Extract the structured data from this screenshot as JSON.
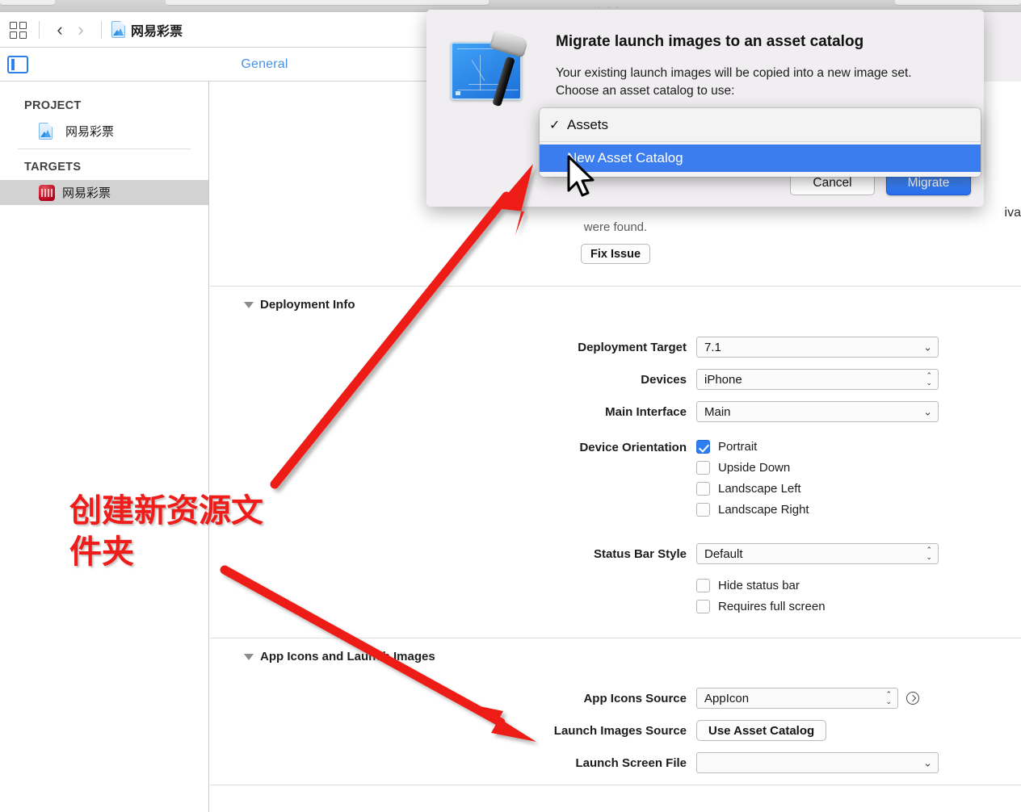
{
  "window": {
    "toolbar": {
      "grid_icon": "grid-icon",
      "back_icon": "‹",
      "forward_icon": "›",
      "breadcrumb_project": "网易彩票"
    },
    "tabbar": {
      "panel_toggle_icon": "left-panel-toggle-icon",
      "active_tab": "General"
    }
  },
  "sidebar": {
    "project_header": "PROJECT",
    "project_items": [
      {
        "label": "网易彩票",
        "icon": "project-file-icon"
      }
    ],
    "targets_header": "TARGETS",
    "target_items": [
      {
        "label": "网易彩票",
        "icon": "app-target-icon",
        "selected": true
      }
    ]
  },
  "content": {
    "issue": {
      "text": "were found.",
      "fix_button": "Fix Issue"
    },
    "deployment_info": {
      "section_title": "Deployment Info",
      "rows": [
        {
          "label": "Deployment Target",
          "value": "7.1",
          "control": "combo"
        },
        {
          "label": "Devices",
          "value": "iPhone",
          "control": "popup"
        },
        {
          "label": "Main Interface",
          "value": "Main",
          "control": "combo"
        }
      ],
      "orientation_label": "Device Orientation",
      "orientations": [
        {
          "label": "Portrait",
          "checked": true
        },
        {
          "label": "Upside Down",
          "checked": false
        },
        {
          "label": "Landscape Left",
          "checked": false
        },
        {
          "label": "Landscape Right",
          "checked": false
        }
      ],
      "status_bar_label": "Status Bar Style",
      "status_bar_value": "Default",
      "status_options": [
        {
          "label": "Hide status bar",
          "checked": false
        },
        {
          "label": "Requires full screen",
          "checked": false
        }
      ]
    },
    "app_icons": {
      "section_title": "App Icons and Launch Images",
      "app_icons_source_label": "App Icons Source",
      "app_icons_source_value": "AppIcon",
      "app_icons_goto_icon": "arrow-right-circle-icon",
      "launch_images_source_label": "Launch Images Source",
      "launch_images_source_button": "Use Asset Catalog",
      "launch_screen_file_label": "Launch Screen File",
      "launch_screen_file_value": ""
    },
    "clipped_edge_text": "iva"
  },
  "dialog": {
    "icon": "xcode-app-icon",
    "title": "Migrate launch images to an asset catalog",
    "body_line_1": "Your existing launch images will be copied into a new image set.",
    "body_line_2": "Choose an asset catalog to use:",
    "cancel_label": "Cancel",
    "migrate_label": "Migrate"
  },
  "dropdown_menu": {
    "items": [
      {
        "label": "Assets",
        "checked": true,
        "highlighted": false
      },
      {
        "label": "New Asset Catalog",
        "checked": false,
        "highlighted": true
      }
    ],
    "check_glyph": "✓"
  },
  "annotations": {
    "note_line_1": "创建新资源文",
    "note_line_2": "件夹",
    "arrow_color": "#ed1c13"
  }
}
